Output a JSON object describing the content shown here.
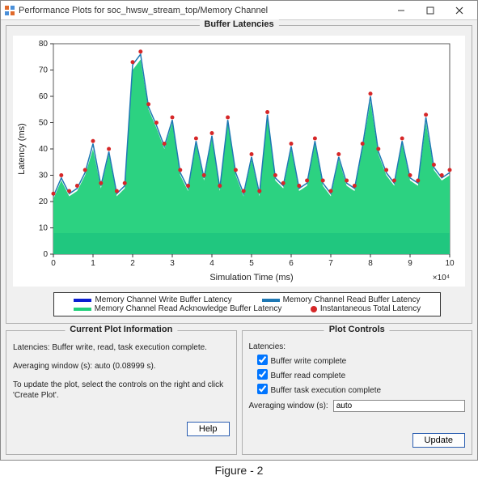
{
  "window": {
    "title": "Performance Plots for soc_hwsw_stream_top/Memory Channel"
  },
  "plot_panel": {
    "title": "Buffer Latencies"
  },
  "chart_data": {
    "type": "line",
    "title": "",
    "xlabel": "Simulation Time (ms)",
    "ylabel": "Latency (ms)",
    "xlim": [
      0,
      10
    ],
    "ylim": [
      0,
      80
    ],
    "x_tick_multiplier_label": "×10⁴",
    "x_ticks": [
      0,
      1,
      2,
      3,
      4,
      5,
      6,
      7,
      8,
      9,
      10
    ],
    "y_ticks": [
      0,
      10,
      20,
      30,
      40,
      50,
      60,
      70,
      80
    ],
    "series": [
      {
        "name": "Memory Channel Write Buffer Latency",
        "style": "area",
        "color": "#0b1fd1",
        "x": [
          0.0,
          10.0
        ],
        "values": [
          8,
          8
        ]
      },
      {
        "name": "Memory Channel Read Acknowledge Buffer Latency",
        "style": "area",
        "color": "#21d07a",
        "x": [
          0.0,
          0.2,
          0.4,
          0.6,
          0.8,
          1.0,
          1.2,
          1.4,
          1.6,
          1.8,
          2.0,
          2.2,
          2.4,
          2.6,
          2.8,
          3.0,
          3.2,
          3.4,
          3.6,
          3.8,
          4.0,
          4.2,
          4.4,
          4.6,
          4.8,
          5.0,
          5.2,
          5.4,
          5.6,
          5.8,
          6.0,
          6.2,
          6.4,
          6.6,
          6.8,
          7.0,
          7.2,
          7.4,
          7.6,
          7.8,
          8.0,
          8.2,
          8.4,
          8.6,
          8.8,
          9.0,
          9.2,
          9.4,
          9.6,
          9.8,
          10.0
        ],
        "values": [
          21,
          28,
          22,
          24,
          30,
          40,
          25,
          38,
          22,
          25,
          70,
          74,
          55,
          48,
          40,
          50,
          30,
          24,
          42,
          28,
          44,
          24,
          50,
          30,
          22,
          36,
          22,
          52,
          28,
          25,
          40,
          24,
          26,
          42,
          26,
          22,
          36,
          26,
          24,
          40,
          58,
          38,
          30,
          26,
          42,
          28,
          26,
          50,
          32,
          28,
          30
        ]
      },
      {
        "name": "Memory Channel Read Buffer Latency",
        "style": "line",
        "color": "#1e78b4",
        "x": [
          0.0,
          0.2,
          0.4,
          0.6,
          0.8,
          1.0,
          1.2,
          1.4,
          1.6,
          1.8,
          2.0,
          2.2,
          2.4,
          2.6,
          2.8,
          3.0,
          3.2,
          3.4,
          3.6,
          3.8,
          4.0,
          4.2,
          4.4,
          4.6,
          4.8,
          5.0,
          5.2,
          5.4,
          5.6,
          5.8,
          6.0,
          6.2,
          6.4,
          6.6,
          6.8,
          7.0,
          7.2,
          7.4,
          7.6,
          7.8,
          8.0,
          8.2,
          8.4,
          8.6,
          8.8,
          9.0,
          9.2,
          9.4,
          9.6,
          9.8,
          10.0
        ],
        "values": [
          22,
          29,
          23,
          25,
          31,
          42,
          26,
          39,
          23,
          26,
          72,
          76,
          56,
          49,
          41,
          51,
          31,
          25,
          43,
          29,
          45,
          25,
          51,
          31,
          23,
          37,
          23,
          53,
          29,
          26,
          41,
          25,
          27,
          43,
          27,
          23,
          37,
          27,
          25,
          41,
          60,
          39,
          31,
          27,
          43,
          29,
          27,
          52,
          33,
          29,
          31
        ]
      },
      {
        "name": "Instantaneous Total Latency",
        "style": "scatter",
        "color": "#d62728",
        "x": [
          0.0,
          0.2,
          0.4,
          0.6,
          0.8,
          1.0,
          1.2,
          1.4,
          1.6,
          1.8,
          2.0,
          2.2,
          2.4,
          2.6,
          2.8,
          3.0,
          3.2,
          3.4,
          3.6,
          3.8,
          4.0,
          4.2,
          4.4,
          4.6,
          4.8,
          5.0,
          5.2,
          5.4,
          5.6,
          5.8,
          6.0,
          6.2,
          6.4,
          6.6,
          6.8,
          7.0,
          7.2,
          7.4,
          7.6,
          7.8,
          8.0,
          8.2,
          8.4,
          8.6,
          8.8,
          9.0,
          9.2,
          9.4,
          9.6,
          9.8,
          10.0
        ],
        "values": [
          23,
          30,
          24,
          26,
          32,
          43,
          27,
          40,
          24,
          27,
          73,
          77,
          57,
          50,
          42,
          52,
          32,
          26,
          44,
          30,
          46,
          26,
          52,
          32,
          24,
          38,
          24,
          54,
          30,
          27,
          42,
          26,
          28,
          44,
          28,
          24,
          38,
          28,
          26,
          42,
          61,
          40,
          32,
          28,
          44,
          30,
          28,
          53,
          34,
          30,
          32
        ]
      }
    ],
    "legend": [
      "Memory Channel Write Buffer Latency",
      "Memory Channel Read Buffer Latency",
      "Memory Channel Read Acknowledge Buffer Latency",
      "Instantaneous Total Latency"
    ]
  },
  "info_panel": {
    "title": "Current Plot Information",
    "line1": "Latencies: Buffer write, read, task execution complete.",
    "line2": "Averaging window (s): auto (0.08999 s).",
    "line3": "To update the plot, select the controls on the right and click 'Create Plot'.",
    "help_btn": "Help"
  },
  "ctrl_panel": {
    "title": "Plot Controls",
    "group_label": "Latencies:",
    "cb1": "Buffer write complete",
    "cb2": "Buffer read complete",
    "cb3": "Buffer task execution complete",
    "avg_label": "Averaging window (s):",
    "avg_value": "auto",
    "update_btn": "Update"
  },
  "caption": "Figure - 2"
}
